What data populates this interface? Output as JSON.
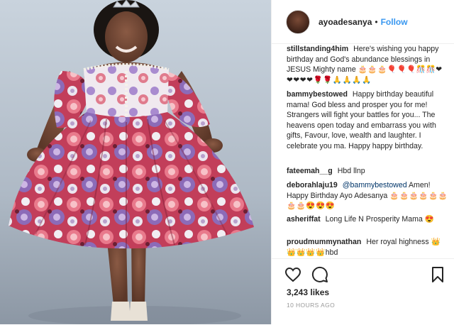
{
  "header": {
    "username": "ayoadesanya",
    "separator": "•",
    "follow_label": "Follow"
  },
  "comments": [
    {
      "user": "stillstanding4him",
      "text": "Here's wishing you happy birthday and God's abundance blessings in JESUS Mighty name",
      "emoji": "🎂🎂🎂🎈🎈🎈🎊🎊❤❤❤❤❤🌹🌹🙏🙏🙏🙏"
    },
    {
      "user": "bammybestowed",
      "text": "Happy birthday beautiful mama! God bless and prosper you for me! Strangers will fight your battles for you... The heavens open today and embarrass you with gifts, Favour, love, wealth and laughter. I celebrate you ma. Happy happy birthday.",
      "emoji": ""
    },
    {
      "user": "fateemah__g",
      "text": "Hbd llnp",
      "emoji": ""
    },
    {
      "user": "deborahlaju19",
      "mention": "@bammybestowed",
      "text": "Amen! Happy Birthday Ayo Adesanya",
      "emoji": "🎂🎂🎂🎂🎂🎂🎂🎂😍😍😍"
    },
    {
      "user": "asheriffat",
      "text": "Long Life N Prosperity Mama",
      "emoji": "😍"
    },
    {
      "user": "proudmummynathan",
      "text": "Her royal highness",
      "emoji": "👑👑👑👑👑",
      "suffix": "hbd"
    }
  ],
  "actions": {
    "like_icon": "heart-outline-icon",
    "comment_icon": "speech-bubble-icon",
    "save_icon": "bookmark-icon",
    "likes": "3,243 likes",
    "time": "10 HOURS AGO"
  },
  "colors": {
    "link_blue": "#3897f0",
    "text": "#262626",
    "muted": "#999999",
    "border": "#efefef"
  }
}
